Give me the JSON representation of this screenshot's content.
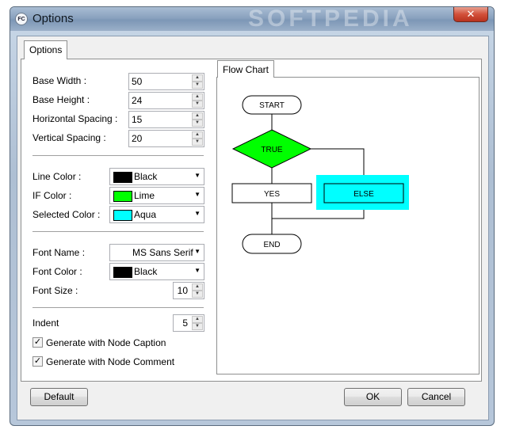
{
  "window": {
    "title": "Options",
    "app_icon_text": "FC",
    "watermark": "SOFTPEDIA",
    "close_glyph": "✕"
  },
  "tabs": {
    "options": "Options",
    "flow_chart": "Flow Chart"
  },
  "fields": {
    "base_width": {
      "label": "Base Width :",
      "value": "50"
    },
    "base_height": {
      "label": "Base Height :",
      "value": "24"
    },
    "horizontal_spacing": {
      "label": "Horizontal Spacing :",
      "value": "15"
    },
    "vertical_spacing": {
      "label": "Vertical Spacing :",
      "value": "20"
    },
    "line_color": {
      "label": "Line Color :",
      "value": "Black",
      "swatch": "#000000"
    },
    "if_color": {
      "label": "IF Color :",
      "value": "Lime",
      "swatch": "#00ff00"
    },
    "selected_color": {
      "label": "Selected Color :",
      "value": "Aqua",
      "swatch": "#00ffff"
    },
    "font_name": {
      "label": "Font Name :",
      "value": "MS Sans Serif"
    },
    "font_color": {
      "label": "Font Color :",
      "value": "Black",
      "swatch": "#000000"
    },
    "font_size": {
      "label": "Font Size :",
      "value": "10"
    },
    "indent": {
      "label": "Indent",
      "value": "5"
    }
  },
  "checkboxes": {
    "node_caption": {
      "label": "Generate with Node Caption",
      "checked": true
    },
    "node_comment": {
      "label": "Generate with Node Comment",
      "checked": true
    }
  },
  "flowchart": {
    "start": "START",
    "decision": "TRUE",
    "yes": "YES",
    "else": "ELSE",
    "end": "END",
    "colors": {
      "decision": "#00ff00",
      "selected": "#00ffff",
      "line": "#000000"
    }
  },
  "buttons": {
    "default": "Default",
    "ok": "OK",
    "cancel": "Cancel"
  },
  "check_glyph": "✓",
  "arrow_up": "▲",
  "arrow_down": "▼"
}
